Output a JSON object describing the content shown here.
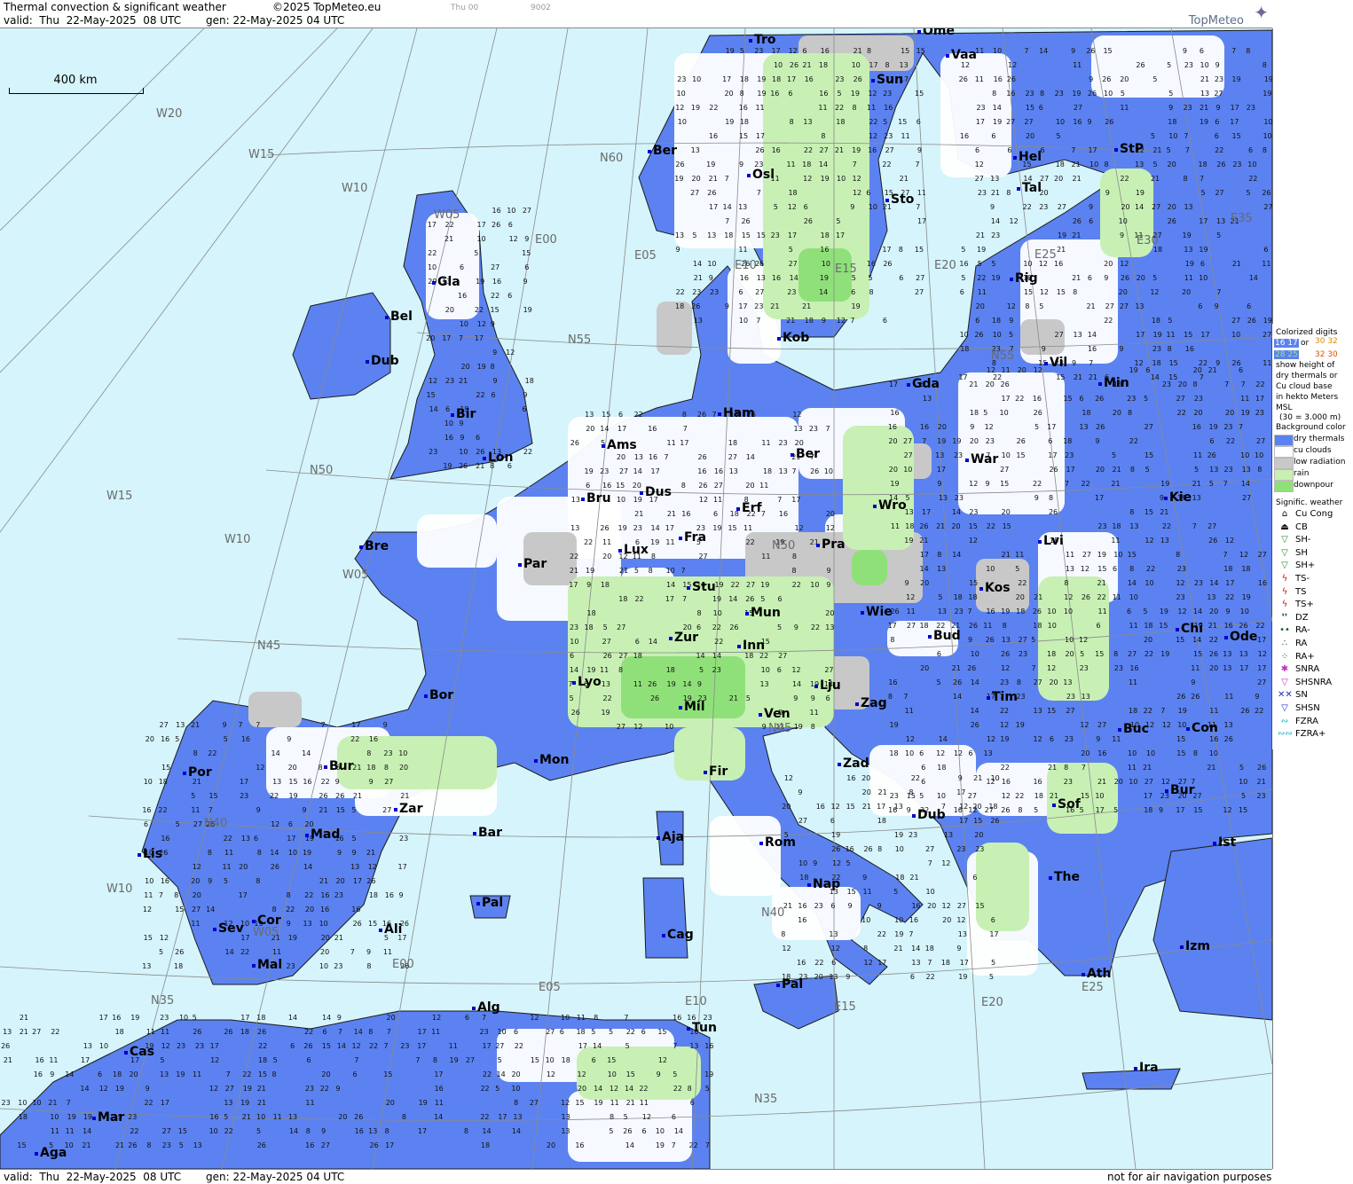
{
  "header": {
    "title": "Thermal convection & significant weather",
    "copyright": "©2025 TopMeteo.eu",
    "valid": "valid:  Thu  22-May-2025  08 UTC",
    "gen": "gen: 22-May-2025 04 UTC",
    "faint_day": "Thu 00",
    "faint_code": "9002",
    "brand": "TopMeteo"
  },
  "footer": {
    "valid": "valid:  Thu  22-May-2025  08 UTC",
    "gen": "gen: 22-May-2025 04 UTC",
    "disclaimer": "not for air navigation purposes"
  },
  "scale": {
    "label": "400 km"
  },
  "legend": {
    "colorized_title": "Colorized digits",
    "sample_1": "16 17",
    "sample_or": "or",
    "sample_2": "30 32",
    "sample_3": "28 25",
    "sample_4": "32 30",
    "desc_1": "show height of",
    "desc_2": "dry thermals or",
    "desc_3": "Cu cloud base",
    "desc_4": "in hekto Meters",
    "desc_5": "MSL",
    "desc_6": "(30 = 3.000 m)",
    "bg_title": "Background color",
    "backgrounds": [
      {
        "label": "dry thermals",
        "color": "#5b82f0"
      },
      {
        "label": "cu clouds",
        "color": "#ffffff"
      },
      {
        "label": "low radiation",
        "color": "#c8c8c8"
      },
      {
        "label": "rain",
        "color": "#c8f0b4"
      },
      {
        "label": "downpour",
        "color": "#90e07a"
      }
    ],
    "wx_title": "Signific. weather",
    "weather": [
      {
        "label": "Cu Cong",
        "symbol": "⌂",
        "color": "#000000"
      },
      {
        "label": "CB",
        "symbol": "⏏",
        "color": "#000000"
      },
      {
        "label": "SH-",
        "symbol": "▽",
        "color": "#2a8a2a"
      },
      {
        "label": "SH",
        "symbol": "▽",
        "color": "#2a8a2a"
      },
      {
        "label": "SH+",
        "symbol": "▽",
        "color": "#2a8a2a"
      },
      {
        "label": "TS-",
        "symbol": "ϟ",
        "color": "#d01010"
      },
      {
        "label": "TS",
        "symbol": "ϟ",
        "color": "#d01010"
      },
      {
        "label": "TS+",
        "symbol": "ϟ",
        "color": "#d01010"
      },
      {
        "label": "DZ",
        "symbol": "❜❜",
        "color": "#1a5a1a"
      },
      {
        "label": "RA-",
        "symbol": "••",
        "color": "#1a5a1a"
      },
      {
        "label": "RA",
        "symbol": "∴",
        "color": "#1a5a1a"
      },
      {
        "label": "RA+",
        "symbol": "⁘",
        "color": "#1a5a1a"
      },
      {
        "label": "SNRA",
        "symbol": "✱",
        "color": "#c030c0"
      },
      {
        "label": "SHSNRA",
        "symbol": "▽",
        "color": "#c030c0"
      },
      {
        "label": "SN",
        "symbol": "✕✕",
        "color": "#2030c0"
      },
      {
        "label": "SHSN",
        "symbol": "▽",
        "color": "#2030c0"
      },
      {
        "label": "FZRA",
        "symbol": "∾",
        "color": "#10b0d0"
      },
      {
        "label": "FZRA+",
        "symbol": "∾∾",
        "color": "#10b0d0"
      }
    ]
  },
  "cities": [
    "Tro",
    "Ome",
    "Vaa",
    "Sun",
    "Ber",
    "Osl",
    "Sto",
    "Hel",
    "StP",
    "Tal",
    "Gla",
    "Bel",
    "Dub",
    "Rig",
    "Kob",
    "Bir",
    "Ham",
    "Gda",
    "Vil",
    "Min",
    "Lon",
    "Ams",
    "Ber",
    "War",
    "Bru",
    "Dus",
    "Erf",
    "Kie",
    "Wro",
    "Lux",
    "Fra",
    "Lvi",
    "Bre",
    "Par",
    "Pra",
    "Stu",
    "Kos",
    "Mun",
    "Wie",
    "Chi",
    "Ode",
    "Bud",
    "Zur",
    "Inn",
    "Lyo",
    "Lju",
    "Bor",
    "Mil",
    "Zag",
    "Tim",
    "Ven",
    "Buc",
    "Con",
    "Por",
    "Bur",
    "Mon",
    "Zad",
    "Fir",
    "Zar",
    "Sof",
    "Bur",
    "Dub",
    "Aja",
    "Mad",
    "Bar",
    "Lis",
    "Rom",
    "Ist",
    "The",
    "Nap",
    "Pal",
    "Cag",
    "Sev",
    "Cor",
    "Ali",
    "Izm",
    "Mal",
    "Ath",
    "Pal",
    "Alg",
    "Tun",
    "Cas",
    "Ira",
    "Mar",
    "Aga"
  ],
  "grid_labels": [
    "W20",
    "W15",
    "W10",
    "W05",
    "E00",
    "E05",
    "E10",
    "E15",
    "E20",
    "E25",
    "E30",
    "E35",
    "N60",
    "N55",
    "N50",
    "N45",
    "N40",
    "N35",
    "W15",
    "W10",
    "W05",
    "W10",
    "W05",
    "E00",
    "E05",
    "E10",
    "E15",
    "E20",
    "E25",
    "N55",
    "N50",
    "N45",
    "N40",
    "N35"
  ],
  "map_colors": {
    "sea": "#d5f4fb",
    "dry_thermals": "#5b82f0",
    "cu_clouds": "#ffffff",
    "low_radiation": "#c8c8c8",
    "rain": "#c8f0b4",
    "downpour": "#90e07a",
    "coast": "#1a1a1a",
    "grid": "#8a8a8a",
    "digit": "#111111"
  },
  "digit_samples": [
    "9",
    "8",
    "11",
    "12",
    "13",
    "14",
    "15",
    "16",
    "17",
    "10",
    "7",
    "6",
    "5",
    "18",
    "19",
    "20",
    "21",
    "22",
    "23",
    "26",
    "27"
  ]
}
